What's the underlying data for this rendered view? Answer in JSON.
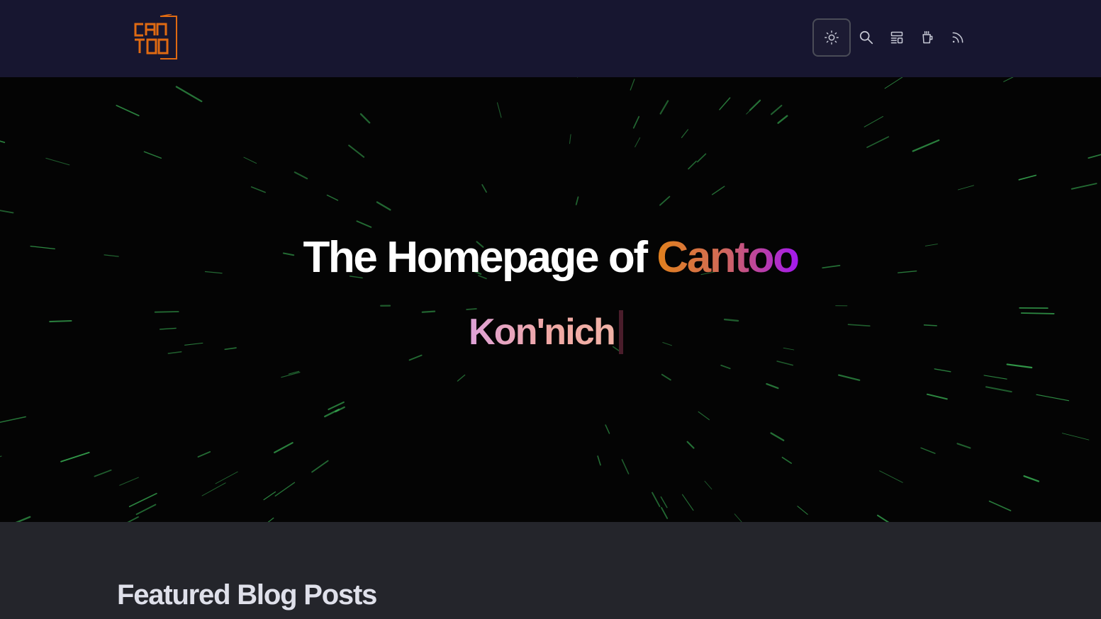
{
  "navbar": {
    "logo": {
      "text_top": "CAN",
      "text_bottom": "TOO",
      "color": "#e06a12"
    },
    "icons": [
      {
        "name": "theme-toggle-sun-icon",
        "icon": "sun"
      },
      {
        "name": "search-icon",
        "icon": "magnifier"
      },
      {
        "name": "layout-icon",
        "icon": "layout"
      },
      {
        "name": "coffee-cup-icon",
        "icon": "cup"
      },
      {
        "name": "rss-feed-icon",
        "icon": "rss"
      }
    ],
    "icon_color": "#c8cad6"
  },
  "hero": {
    "title_prefix": "The Homepage of ",
    "title_brand": "Cantoo",
    "typed_text": "Kon'nich",
    "starfield_color": "#3dbd5a"
  },
  "featured": {
    "title": "Featured Blog Posts"
  }
}
